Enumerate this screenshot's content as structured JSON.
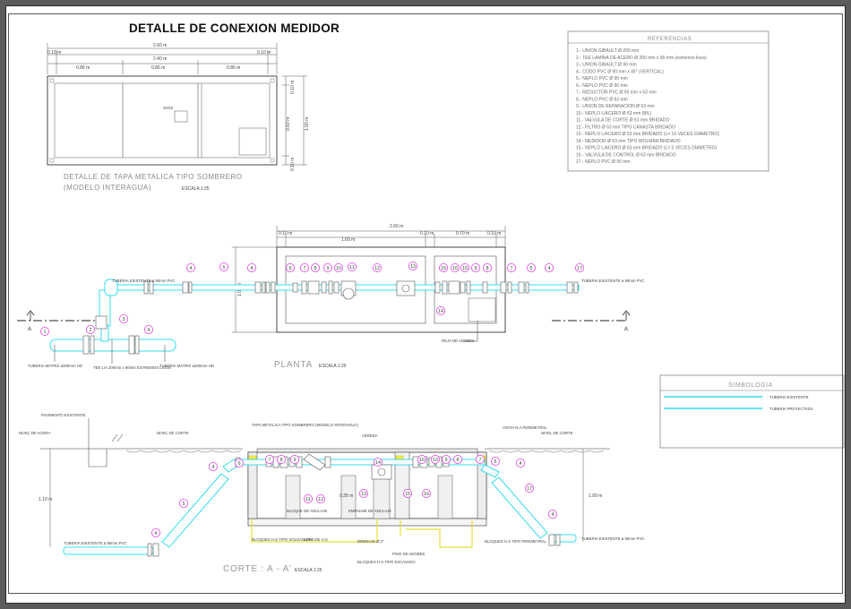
{
  "title": "DETALLE DE CONEXION MEDIDOR",
  "tapa": {
    "caption_line1": "DETALLE DE TAPA METALICA TIPO SOMBRERO",
    "caption_line2": "(MODELO INTERAGUA)",
    "scale": "ESCALA 1:25",
    "dims_top": [
      "2.60 m",
      "0.10 m",
      "2.40 m",
      "0.10 m"
    ],
    "dims_bottom": [
      "0.86 m",
      "0.86 m",
      "0.86 m"
    ],
    "dims_side": [
      "0.10 m",
      "0.60 m",
      "1.00 m",
      "0.10 m"
    ],
    "box_label": "XXXX"
  },
  "references": {
    "header": "REFERENCIAS",
    "items": [
      "1.- UNION GIBAULT Ø 200 mm",
      "2.- TEE LAMINA DE ACERO Ø 200 mm x 90 mm (extremos lisos)",
      "3.- UNION GIBAULT Ø 90 mm",
      "4.- CODO PVC Ø 90 mm x 45° (VERTICAL)",
      "5.- NEPLO PVC Ø 90 mm",
      "6.- NEPLO PVC Ø 90 mm",
      "7.- REDUCTOR PVC Ø 90 mm x 63 mm",
      "8.- NEPLO PVC Ø 63 mm",
      "9.- UNION DE REPARACION Ø 63 mm",
      "10.- NEPLO L/ACERO Ø 63 mm (B/L)",
      "11.- VALVULA DE CORTE Ø 63 mm BRIDADO",
      "12.- FILTRO Ø 63 mm TIPO CANASTA BRIDADO",
      "13.- NEPLO L/ACERO Ø 63 mm BRIDADO (L= 10 VECES DIAMETRO)",
      "14.- MEDIDOR Ø 63 mm TIPO WOLMAN BRIDADO",
      "15.- NEPLO L/ACERO Ø 63 mm BRIDADO (L= 5 VECES DIAMETRO)",
      "16.- VALVULA DE CONTROL Ø 63 mm BRIDADO",
      "17.- NEPLO PVC Ø 90 mm"
    ]
  },
  "planta": {
    "label": "PLANTA",
    "scale": "ESCALA 1:25",
    "dims_top": [
      "2.60 m",
      "0.10 m",
      "1.60 m",
      "0.10 m",
      "0.70 m",
      "0.10 m"
    ],
    "dim_side": "1.00 m",
    "section_marker": "A",
    "note_existing_left": "TUBERIA EXISTENTE ø 90mm PVC",
    "note_existing_right": "TUBERIA EXISTENTE ø 90mm PVC",
    "note_matriz_left": "TUBERIA MATRIZ ø200mm HD",
    "note_matriz_right": "TUBERIA MATRIZ ø200mm HD",
    "note_tee": "TEE L/A 200mm x 90mm EXTREMOS LISOS",
    "note_rejilla": "REJA DE ADOBES",
    "callouts": [
      "1",
      "2",
      "3",
      "4",
      "5",
      "4",
      "6",
      "7",
      "8",
      "9",
      "10",
      "11",
      "12",
      "13",
      "14",
      "15",
      "16",
      "10",
      "9",
      "8",
      "7",
      "6",
      "4",
      "17",
      "4",
      "1"
    ]
  },
  "simbologia": {
    "header": "SIMBOLOGIA",
    "items": [
      {
        "label": "TUBERIA EXISTENTE",
        "color": "#35dcef"
      },
      {
        "label": "TUBERIA PROYECTADA",
        "color": "#35dcef"
      }
    ]
  },
  "corte": {
    "label": "CORTE : A - A'",
    "scale": "ESCALA 1:25",
    "notes": {
      "ground_left": "NIVEL DE ACERA",
      "ground_left2": "NIVEL DE CORTE",
      "ground_right": "NIVEL DE CORTE",
      "existing_slab": "PAVIMENTO EXISTENTE",
      "tapa": "TAPA METALICA TIPO SOMBRERO (MODELO INTERAGUA)",
      "vereda": "VEREDA",
      "visita": "VISITA N.A PERIMETRAL",
      "bloque_anclaje": "BLOQUE DE ANCLAJE",
      "empalme": "EMPALME DE ANCLAJE",
      "bloques_hs_left": "BLOQUES H.S TIPO SOLDADURA",
      "losa": "LOSA DE H.S",
      "drenaje": "DRENAJE Ø 2\"",
      "piso": "PISO DE ADOBES",
      "bloques_hs_mid": "BLOQUES H.S TIPO ESCAVADO",
      "bloques_hs_right": "BLOQUES H.S TIPO PERIMETRAL",
      "pipe_left": "TUBERIA EXISTENTE ø 90mm PVC",
      "pipe_right": "TUBERIA EXISTENTE ø 90mm PVC",
      "dim_left": "1.10 m",
      "dim_right": "1.00 m",
      "dim_mid": "0.35 m"
    },
    "callouts": [
      "6",
      "7",
      "8",
      "9",
      "4",
      "5",
      "4",
      "10",
      "11",
      "12",
      "13",
      "14",
      "15",
      "16",
      "10",
      "9",
      "8",
      "7",
      "6",
      "4",
      "17",
      "4"
    ]
  }
}
